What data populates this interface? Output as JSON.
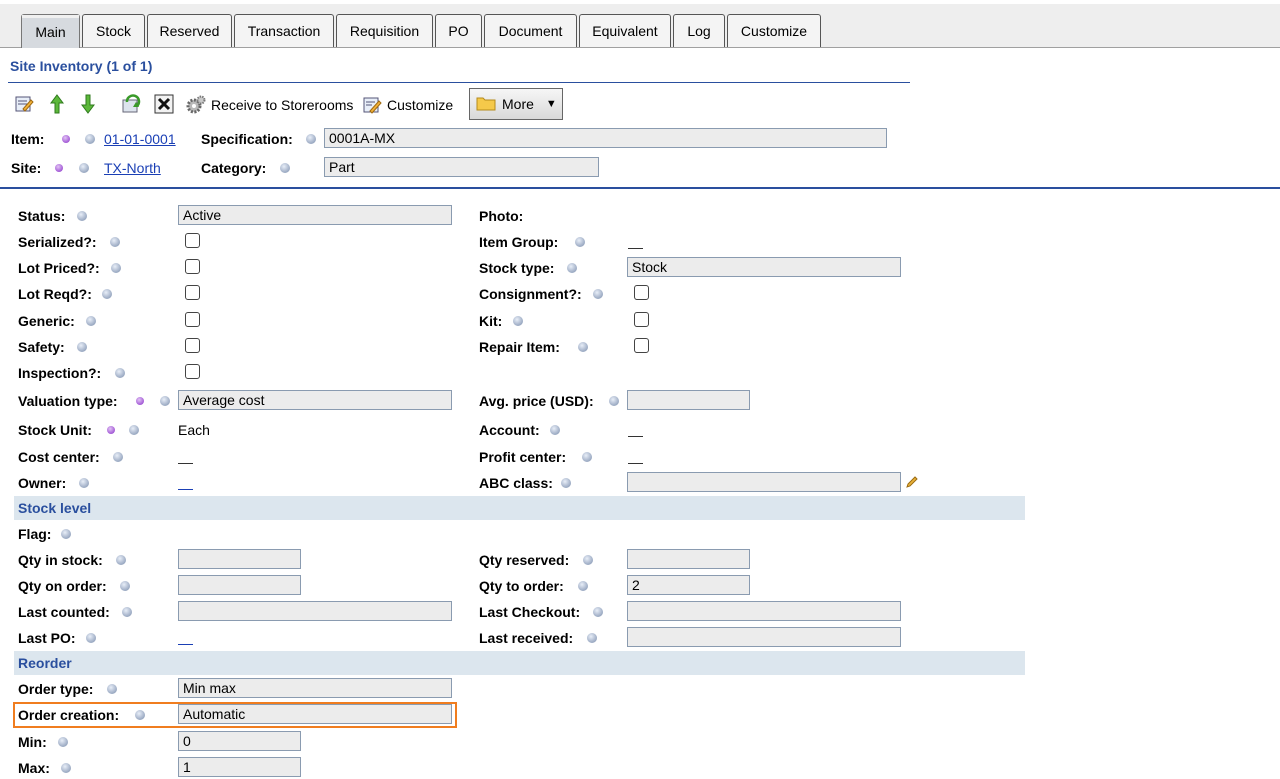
{
  "tabs": [
    "Main",
    "Stock",
    "Reserved",
    "Transaction",
    "Requisition",
    "PO",
    "Document",
    "Equivalent",
    "Log",
    "Customize"
  ],
  "section_title": "Site Inventory (1 of 1)",
  "toolbar": {
    "receive_label": "Receive to Storerooms",
    "customize_label": "Customize",
    "more_label": "More"
  },
  "header": {
    "item_label": "Item:",
    "item_value": "01-01-0001",
    "site_label": "Site:",
    "site_value": "TX-North",
    "spec_label": "Specification:",
    "spec_value": "0001A-MX",
    "category_label": "Category:",
    "category_value": "Part"
  },
  "left_fields": {
    "status_label": "Status:",
    "status_value": "Active",
    "serialized_label": "Serialized?:",
    "lot_priced_label": "Lot Priced?:",
    "lot_reqd_label": "Lot Reqd?:",
    "generic_label": "Generic:",
    "safety_label": "Safety:",
    "inspection_label": "Inspection?:",
    "valuation_label": "Valuation type:",
    "valuation_value": "Average cost",
    "stock_unit_label": "Stock Unit:",
    "stock_unit_value": "Each",
    "cost_center_label": "Cost center:",
    "owner_label": "Owner:"
  },
  "right_fields": {
    "photo_label": "Photo:",
    "item_group_label": "Item Group:",
    "stock_type_label": "Stock type:",
    "stock_type_value": "Stock",
    "consignment_label": "Consignment?:",
    "kit_label": "Kit:",
    "repair_label": "Repair Item:",
    "avg_price_label": "Avg. price (USD):",
    "account_label": "Account:",
    "profit_center_label": "Profit center:",
    "abc_label": "ABC class:"
  },
  "stock_level": {
    "title": "Stock level",
    "flag_label": "Flag:",
    "qty_in_stock_label": "Qty in stock:",
    "qty_on_order_label": "Qty on order:",
    "last_counted_label": "Last counted:",
    "last_po_label": "Last PO:",
    "qty_reserved_label": "Qty reserved:",
    "qty_to_order_label": "Qty to order:",
    "qty_to_order_value": "2",
    "last_checkout_label": "Last Checkout:",
    "last_received_label": "Last received:"
  },
  "reorder": {
    "title": "Reorder",
    "order_type_label": "Order type:",
    "order_type_value": "Min max",
    "order_creation_label": "Order creation:",
    "order_creation_value": "Automatic",
    "min_label": "Min:",
    "min_value": "0",
    "max_label": "Max:",
    "max_value": "1"
  },
  "colors": {
    "accent": "#2a4f9e",
    "highlight": "#f07d1f",
    "band": "#dce6ee"
  }
}
